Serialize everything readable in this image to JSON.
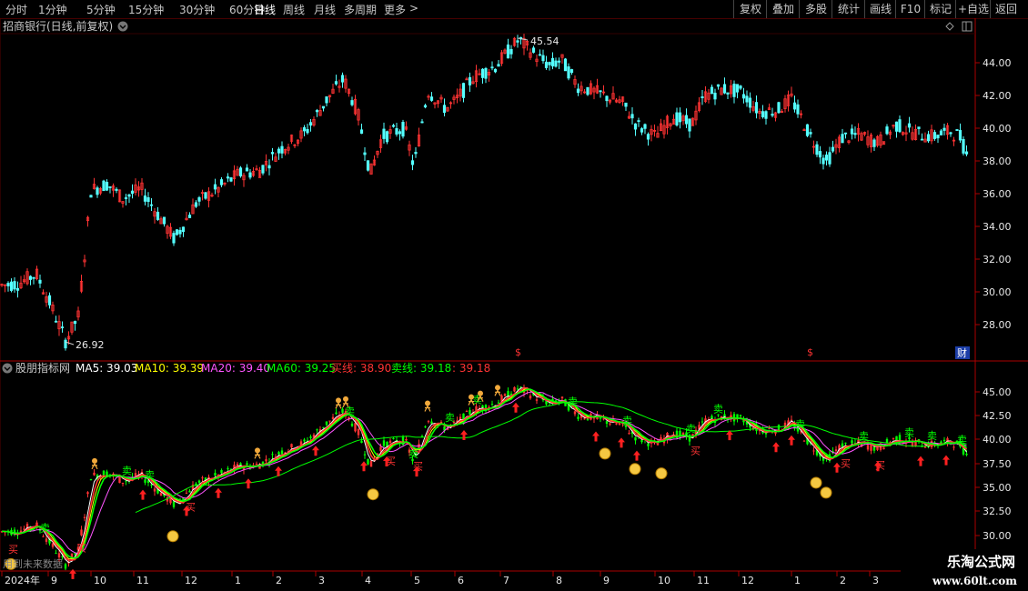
{
  "toolbar": {
    "periods": [
      "分时",
      "1分钟",
      "5分钟",
      "15分钟",
      "30分钟",
      "60分钟",
      "日线",
      "周线",
      "月线",
      "多周期",
      "更多"
    ],
    "active_period": "日线",
    "more_arrow": ">",
    "right_buttons": [
      "复权",
      "叠加",
      "多股",
      "统计",
      "画线",
      "F10",
      "标记",
      "+自选",
      "返回"
    ]
  },
  "main_chart": {
    "title": "招商银行(日线,前复权)",
    "high_label": "45.54",
    "low_label": "26.92",
    "price_ticks": [
      "44.00",
      "42.00",
      "40.00",
      "38.00",
      "36.00",
      "34.00",
      "32.00",
      "30.00",
      "28.00"
    ],
    "dollar_marker": "$",
    "finance_badge": "财"
  },
  "indicator_panel": {
    "name": "股朋指标网",
    "ma5": "MA5: 39.03",
    "ma10": "MA10: 39.39",
    "ma20": "MA20: 39.40",
    "ma60": "MA60: 39.25",
    "buy_line": "买线: 38.90",
    "sell_line": "卖线: 39.18",
    "extra": ": 39.18",
    "ticks": [
      "45.00",
      "42.50",
      "40.00",
      "37.50",
      "35.00",
      "32.50",
      "30.00"
    ],
    "sell_marker": "卖",
    "buy_marker": "买",
    "footer_note": "用到未来数据"
  },
  "time_axis": [
    "2024年",
    "9",
    "10",
    "11",
    "12",
    "1",
    "2",
    "3",
    "4",
    "5",
    "6",
    "7",
    "8",
    "9",
    "10",
    "11",
    "12",
    "1",
    "2",
    "3"
  ],
  "watermark": {
    "title": "乐淘公式网",
    "url": "www.60lt.com"
  },
  "colors": {
    "up": "#ff3333",
    "down": "#54ffff",
    "ma5": "#ffffff",
    "ma10": "#ffff00",
    "ma20": "#ff55ff",
    "ma60": "#00ff00",
    "buy": "#ff3333",
    "sell": "#00ff00",
    "grid": "#550000"
  }
}
